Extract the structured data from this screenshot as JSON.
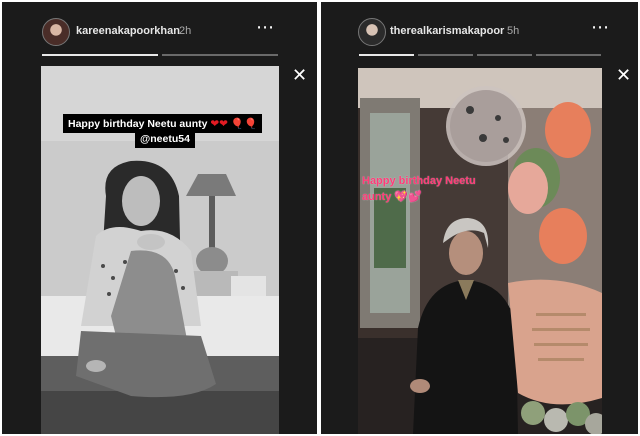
{
  "stories": [
    {
      "username": "kareenakapoorkhan",
      "time": "2h",
      "caption": {
        "line1": "Happy birthday Neetu aunty",
        "line1_emojis": "❤❤",
        "line1_balloons": "🎈🎈",
        "mention": "@neetu54"
      }
    },
    {
      "username": "therealkarismakapoor",
      "time": "5h",
      "caption": {
        "line1": "Happy birthday Neetu",
        "line2": "aunty",
        "emojis": "💖💕"
      }
    }
  ],
  "icons": {
    "more": "⋯",
    "close": "✕"
  }
}
